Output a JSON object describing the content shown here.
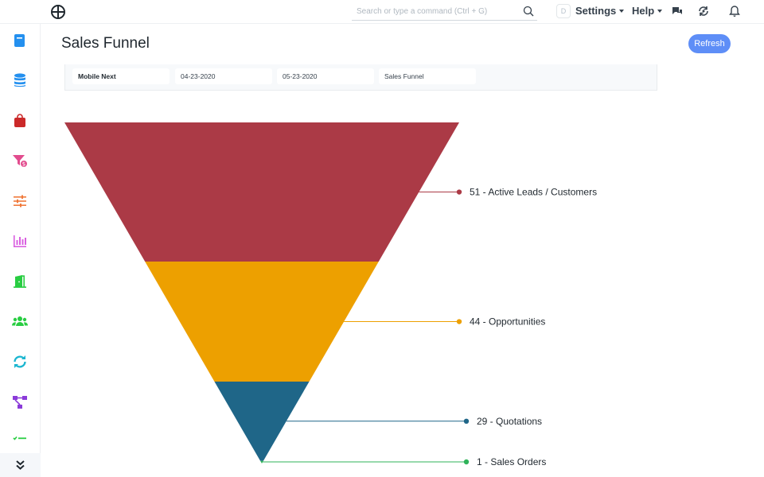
{
  "navbar": {
    "search_placeholder": "Search or type a command (Ctrl + G)",
    "avatar_letter": "D",
    "settings_label": "Settings",
    "help_label": "Help"
  },
  "sidebar": {
    "items": [
      {
        "icon": "book-icon",
        "color": "#2490ef"
      },
      {
        "icon": "database-icon",
        "color": "#2490ef"
      },
      {
        "icon": "shopping-bag-icon",
        "color": "#cb2929"
      },
      {
        "icon": "funnel-dollar-icon",
        "color": "#e24c8e"
      },
      {
        "icon": "sliders-icon",
        "color": "#f07a3c"
      },
      {
        "icon": "bar-chart-icon",
        "color": "#d95fe0"
      },
      {
        "icon": "door-open-icon",
        "color": "#29cd42"
      },
      {
        "icon": "users-icon",
        "color": "#29cd42"
      },
      {
        "icon": "sync-icon",
        "color": "#1bb6d0"
      },
      {
        "icon": "sitemap-icon",
        "color": "#8b3bd9"
      },
      {
        "icon": "checklist-icon",
        "color": "#29cd42"
      }
    ],
    "more_icon": "double-chevron-down-icon"
  },
  "page": {
    "title": "Sales Funnel",
    "refresh_label": "Refresh"
  },
  "filters": {
    "company": "Mobile Next",
    "from_date": "04-23-2020",
    "to_date": "05-23-2020",
    "report": "Sales Funnel"
  },
  "chart_data": {
    "type": "funnel",
    "title": "",
    "stages": [
      {
        "label": "Active Leads / Customers",
        "value": 51,
        "color": "#ab3a46"
      },
      {
        "label": "Opportunities",
        "value": 44,
        "color": "#eda000"
      },
      {
        "label": "Quotations",
        "value": 29,
        "color": "#1f6688"
      },
      {
        "label": "Sales Orders",
        "value": 1,
        "color": "#2fb35a"
      }
    ]
  }
}
